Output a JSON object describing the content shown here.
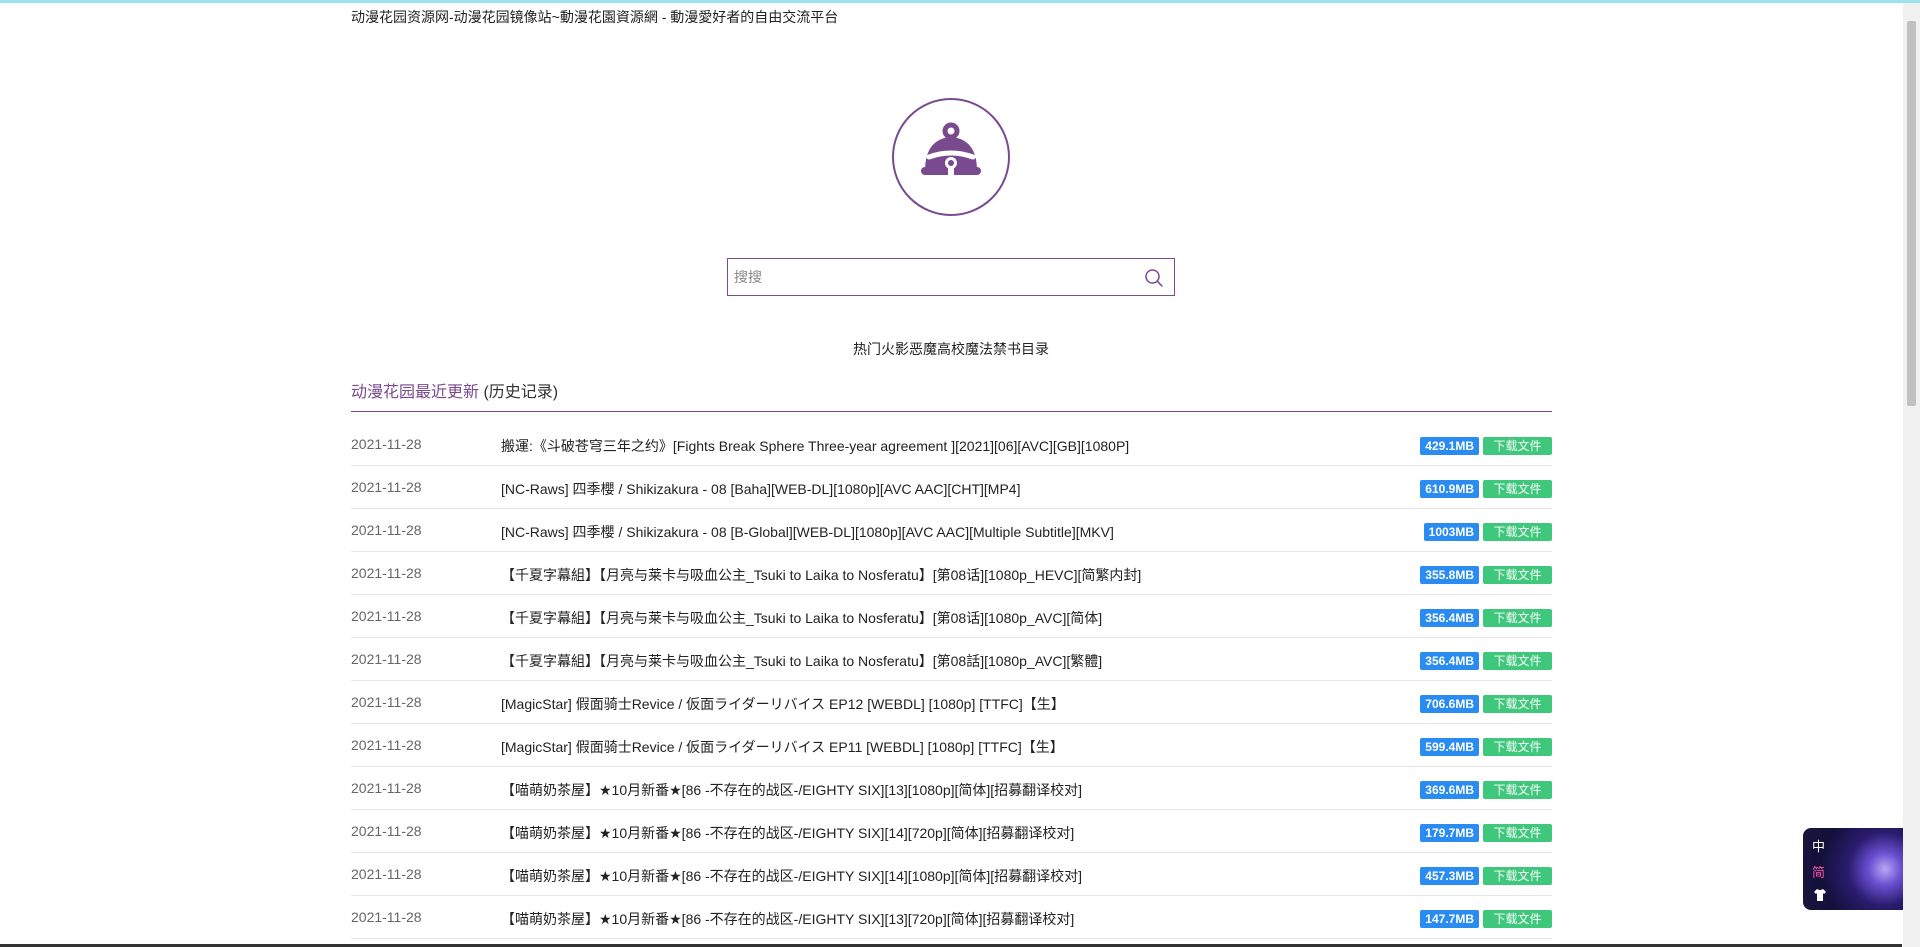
{
  "site_title": "动漫花园资源网-动漫花园镜像站~動漫花園資源網 - 動漫愛好者的自由交流平台",
  "search": {
    "placeholder": "搜搜",
    "value": ""
  },
  "hot_keywords": [
    "热门",
    "火影",
    "恶魔高校",
    "魔法禁书目录"
  ],
  "section": {
    "title": "动漫花园最近更新",
    "history_label": "(历史记录)"
  },
  "download_label": "下载文件",
  "rows": [
    {
      "date": "2021-11-28",
      "title": "搬運:《斗破苍穹三年之约》[Fights Break Sphere Three-year agreement ][2021][06][AVC][GB][1080P]",
      "size": "429.1MB"
    },
    {
      "date": "2021-11-28",
      "title": "[NC-Raws] 四季櫻 / Shikizakura - 08 [Baha][WEB-DL][1080p][AVC AAC][CHT][MP4]",
      "size": "610.9MB"
    },
    {
      "date": "2021-11-28",
      "title": "[NC-Raws] 四季櫻 / Shikizakura - 08 [B-Global][WEB-DL][1080p][AVC AAC][Multiple Subtitle][MKV]",
      "size": "1003MB"
    },
    {
      "date": "2021-11-28",
      "title": "【千夏字幕組】【月亮与莱卡与吸血公主_Tsuki to Laika to Nosferatu】[第08话][1080p_HEVC][简繁内封]",
      "size": "355.8MB"
    },
    {
      "date": "2021-11-28",
      "title": "【千夏字幕組】【月亮与莱卡与吸血公主_Tsuki to Laika to Nosferatu】[第08话][1080p_AVC][简体]",
      "size": "356.4MB"
    },
    {
      "date": "2021-11-28",
      "title": "【千夏字幕組】【月亮与莱卡与吸血公主_Tsuki to Laika to Nosferatu】[第08話][1080p_AVC][繁體]",
      "size": "356.4MB"
    },
    {
      "date": "2021-11-28",
      "title": "[MagicStar] 假面骑士Revice / 仮面ライダーリバイス EP12 [WEBDL] [1080p] [TTFC]【生】",
      "size": "706.6MB"
    },
    {
      "date": "2021-11-28",
      "title": "[MagicStar] 假面骑士Revice / 仮面ライダーリバイス EP11 [WEBDL] [1080p] [TTFC]【生】",
      "size": "599.4MB"
    },
    {
      "date": "2021-11-28",
      "title": "【喵萌奶茶屋】★10月新番★[86 -不存在的战区-/EIGHTY SIX][13][1080p][简体][招募翻译校对]",
      "size": "369.6MB"
    },
    {
      "date": "2021-11-28",
      "title": "【喵萌奶茶屋】★10月新番★[86 -不存在的战区-/EIGHTY SIX][14][720p][简体][招募翻译校对]",
      "size": "179.7MB"
    },
    {
      "date": "2021-11-28",
      "title": "【喵萌奶茶屋】★10月新番★[86 -不存在的战区-/EIGHTY SIX][14][1080p][简体][招募翻译校对]",
      "size": "457.3MB"
    },
    {
      "date": "2021-11-28",
      "title": "【喵萌奶茶屋】★10月新番★[86 -不存在的战区-/EIGHTY SIX][13][720p][简体][招募翻译校对]",
      "size": "147.7MB"
    }
  ],
  "lang_widget": {
    "traditional": "中",
    "simplified": "简",
    "icon": "shirt-icon"
  },
  "icons": {
    "logo": "bell-logo-icon",
    "search": "search-icon"
  },
  "colors": {
    "brand": "#7a4a8f",
    "size_badge": "#2a8cf0",
    "download_button": "#3fc87c"
  }
}
